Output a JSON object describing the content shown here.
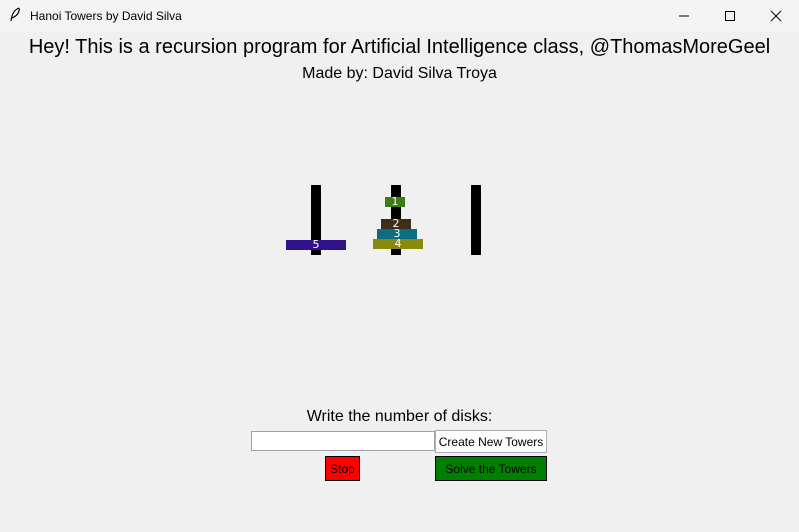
{
  "window": {
    "title": "Hanoi Towers by David Silva",
    "app_icon": "feather-icon",
    "controls": [
      "minimize-icon",
      "maximize-icon",
      "close-icon"
    ]
  },
  "header": {
    "title": "Hey! This is a recursion program for Artificial Intelligence class, @ThomasMoreGeel",
    "subtitle": "Made by: David Silva Troya"
  },
  "towers": {
    "pegs": [
      {
        "disks": [
          {
            "label": "5",
            "color": "#31108a"
          }
        ]
      },
      {
        "disks": [
          {
            "label": "4",
            "color": "#8a8a0a"
          },
          {
            "label": "3",
            "color": "#0a6e80"
          },
          {
            "label": "2",
            "color": "#3e2d17"
          },
          {
            "label": "1",
            "color": "#3f7d14"
          }
        ]
      },
      {
        "disks": []
      }
    ]
  },
  "controls": {
    "prompt": "Write the number of disks:",
    "disk_count_value": "",
    "create_label": "Create New Towers",
    "stop_label": "Stop",
    "solve_label": "Solve the Towers",
    "stop_color": "#ff0000",
    "solve_color": "#008000"
  }
}
